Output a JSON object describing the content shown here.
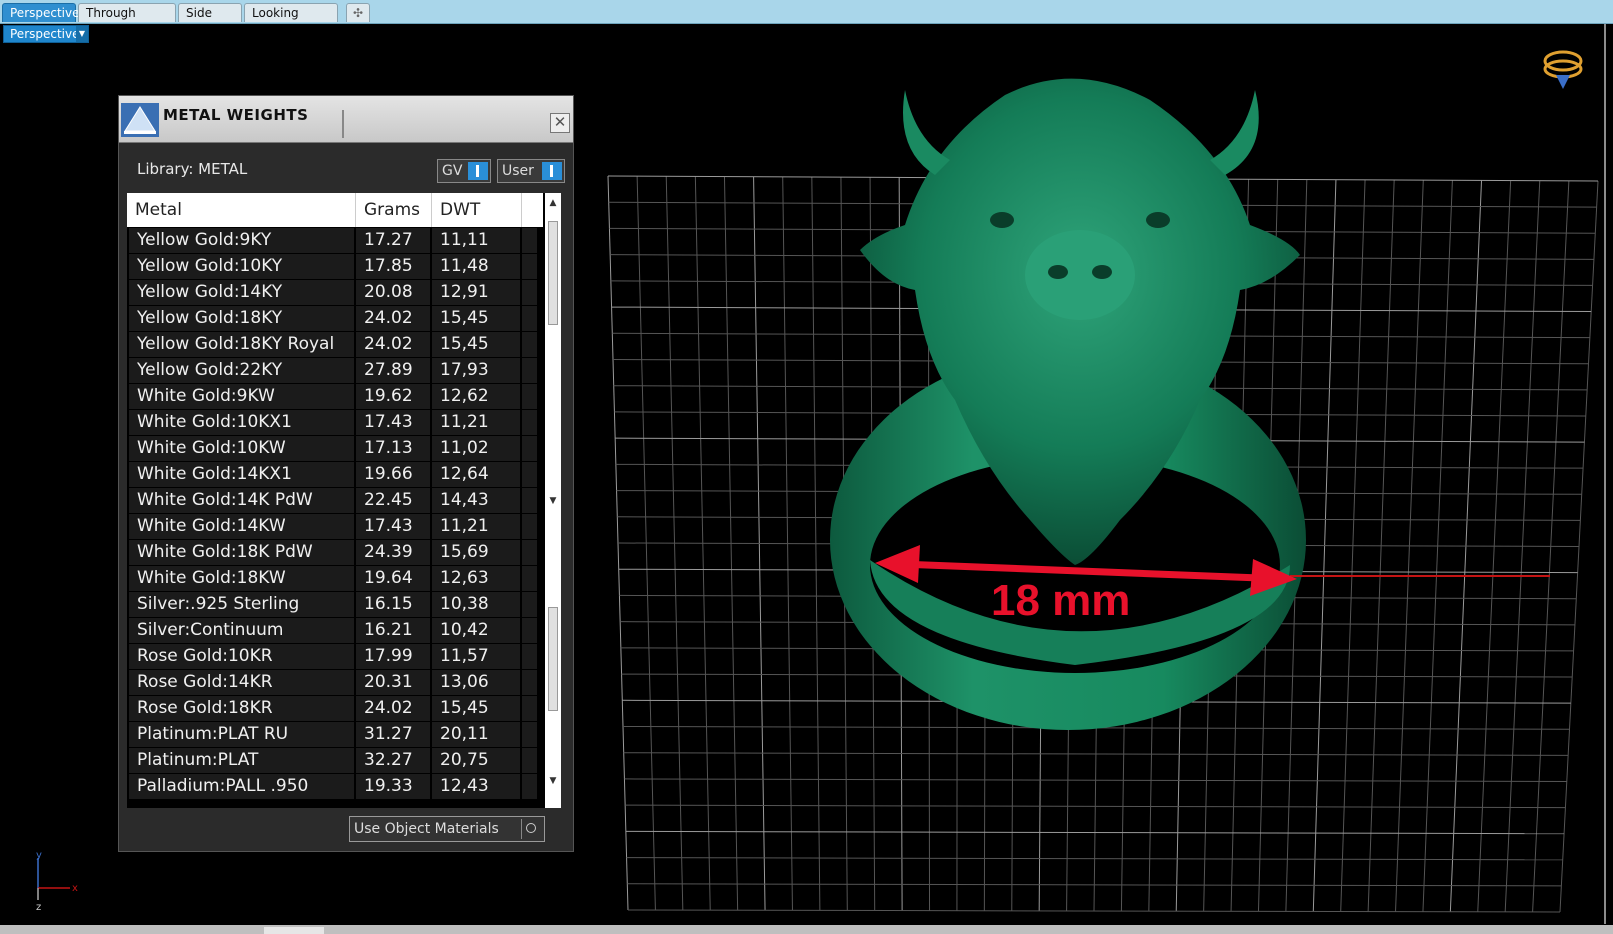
{
  "tabs": [
    {
      "label": "Perspective",
      "active": true
    },
    {
      "label": "Through Finger",
      "active": false
    },
    {
      "label": "Side View",
      "active": false
    },
    {
      "label": "Looking Down",
      "active": false
    }
  ],
  "viewport": {
    "view_dropdown": "Perspective",
    "dimension_label": "18 mm",
    "axis": {
      "x": "x",
      "y": "y",
      "z": "z"
    }
  },
  "panel": {
    "title": "METAL WEIGHTS",
    "library_label": "Library: METAL",
    "toggle_gv": "GV",
    "toggle_user": "User",
    "use_object_materials": "Use Object Materials",
    "columns": [
      "Metal",
      "Grams",
      "DWT"
    ],
    "rows": [
      [
        "Yellow Gold:9KY",
        "17.27",
        "11,11"
      ],
      [
        "Yellow Gold:10KY",
        "17.85",
        "11,48"
      ],
      [
        "Yellow Gold:14KY",
        "20.08",
        "12,91"
      ],
      [
        "Yellow Gold:18KY",
        "24.02",
        "15,45"
      ],
      [
        "Yellow Gold:18KY Royal",
        "24.02",
        "15,45"
      ],
      [
        "Yellow Gold:22KY",
        "27.89",
        "17,93"
      ],
      [
        "White Gold:9KW",
        "19.62",
        "12,62"
      ],
      [
        "White Gold:10KX1",
        "17.43",
        "11,21"
      ],
      [
        "White Gold:10KW",
        "17.13",
        "11,02"
      ],
      [
        "White Gold:14KX1",
        "19.66",
        "12,64"
      ],
      [
        "White Gold:14K PdW",
        "22.45",
        "14,43"
      ],
      [
        "White Gold:14KW",
        "17.43",
        "11,21"
      ],
      [
        "White Gold:18K PdW",
        "24.39",
        "15,69"
      ],
      [
        "White Gold:18KW",
        "19.64",
        "12,63"
      ],
      [
        "Silver:.925 Sterling",
        "16.15",
        "10,38"
      ],
      [
        "Silver:Continuum",
        "16.21",
        "10,42"
      ],
      [
        "Rose Gold:10KR",
        "17.99",
        "11,57"
      ],
      [
        "Rose Gold:14KR",
        "20.31",
        "13,06"
      ],
      [
        "Rose Gold:18KR",
        "24.02",
        "15,45"
      ],
      [
        "Platinum:PLAT RU",
        "31.27",
        "20,11"
      ],
      [
        "Platinum:PLAT",
        "32.27",
        "20,75"
      ],
      [
        "Palladium:PALL .950",
        "19.33",
        "12,43"
      ]
    ]
  },
  "colors": {
    "tab_active": "#2f8fd0",
    "ring_green": "#137a55",
    "dimension_red": "#e8112b",
    "grid": "#8a8a8a"
  },
  "icons": [
    "scale-icon",
    "close-icon",
    "view-cube-icon",
    "dropdown-caret-icon",
    "add-tab-icon"
  ]
}
